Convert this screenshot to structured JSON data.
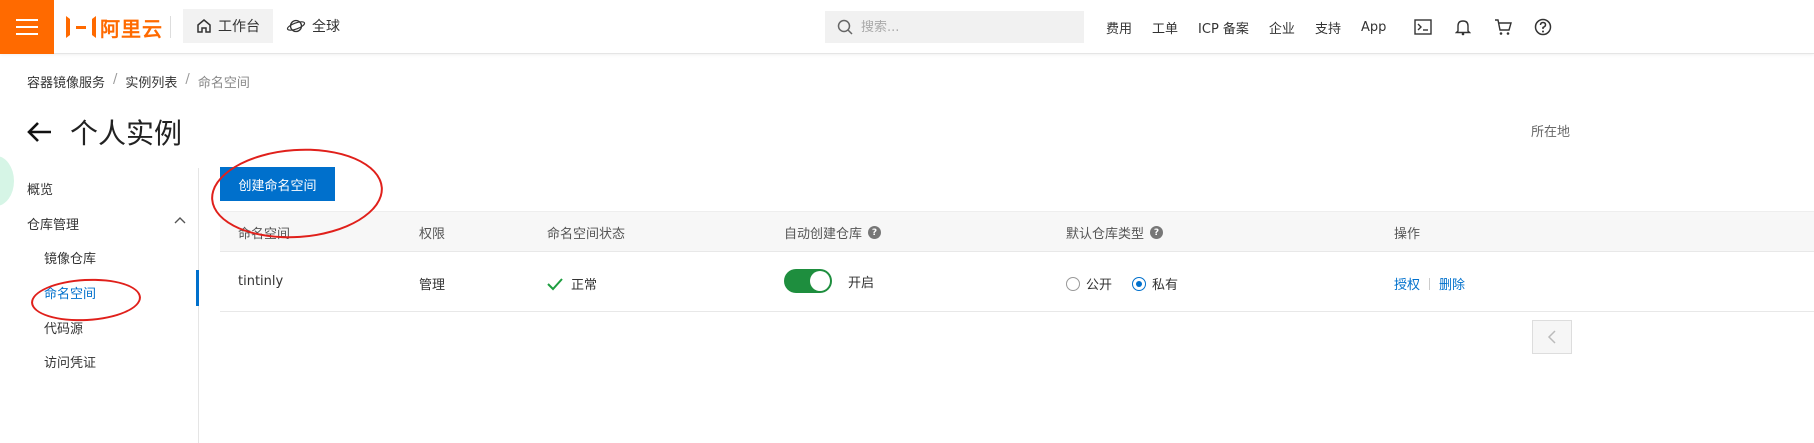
{
  "topbar": {
    "logo_text": "阿里云",
    "workbench_label": "工作台",
    "global_label": "全球",
    "search_placeholder": "搜索...",
    "links": [
      "费用",
      "工单",
      "ICP 备案",
      "企业",
      "支持",
      "App"
    ],
    "icons": [
      "terminal-icon",
      "bell-icon",
      "cart-icon",
      "help-icon"
    ],
    "brand_color": "#ff6a00"
  },
  "breadcrumb": {
    "items": [
      "容器镜像服务",
      "实例列表",
      "命名空间"
    ]
  },
  "page": {
    "title": "个人实例",
    "region_label": "所在地"
  },
  "sidebar": {
    "overview": "概览",
    "repo_mgmt": "仓库管理",
    "items": [
      "镜像仓库",
      "命名空间",
      "代码源",
      "访问凭证"
    ],
    "active": "命名空间"
  },
  "content": {
    "create_button": "创建命名空间",
    "columns": [
      "命名空间",
      "权限",
      "命名空间状态",
      "自动创建仓库",
      "默认仓库类型",
      "操作"
    ],
    "rows": [
      {
        "namespace": "tintinly",
        "permission": "管理",
        "status": "正常",
        "auto_create": "开启",
        "auto_create_on": true,
        "repo_type_options": [
          "公开",
          "私有"
        ],
        "repo_type_selected": "私有",
        "actions": [
          "授权",
          "删除"
        ]
      }
    ],
    "accent_color": "#0070cc"
  }
}
